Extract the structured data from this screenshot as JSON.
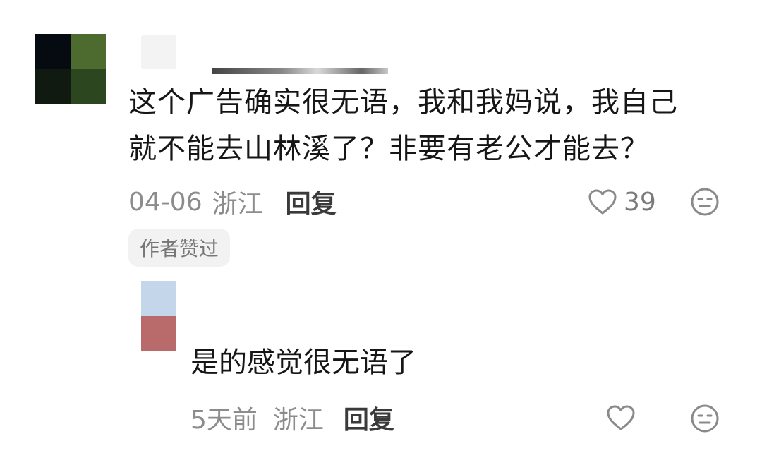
{
  "comment": {
    "lines": [
      "这个广告确实很无语，我和我妈说，我自己",
      "就不能去山林溪了？非要有老公才能去？"
    ],
    "date": "04-06",
    "location": "浙江",
    "reply_label": "回复",
    "likes": "39",
    "author_badge": "作者赞过",
    "icons": {
      "like": "heart-outline-icon",
      "dislike": "neutral-face-icon"
    }
  },
  "reply": {
    "text": "是的感觉很无语了",
    "date": "5天前",
    "location": "浙江",
    "reply_label": "回复",
    "icons": {
      "like": "heart-outline-icon",
      "dislike": "neutral-face-icon"
    }
  },
  "colors": {
    "text": "#161616",
    "meta": "#8c8c8c",
    "badge_bg": "#f2f2f2"
  }
}
